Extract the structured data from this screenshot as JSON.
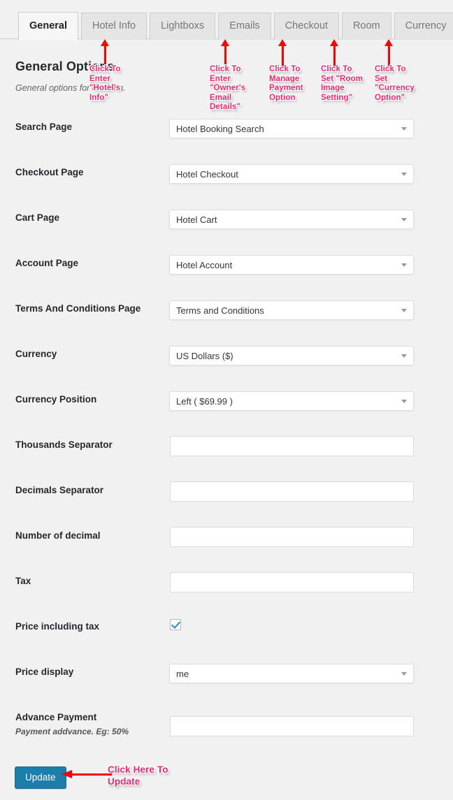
{
  "tabs": [
    {
      "label": "General",
      "active": true
    },
    {
      "label": "Hotel Info",
      "active": false
    },
    {
      "label": "Lightboxs",
      "active": false
    },
    {
      "label": "Emails",
      "active": false
    },
    {
      "label": "Checkout",
      "active": false
    },
    {
      "label": "Room",
      "active": false
    },
    {
      "label": "Currency",
      "active": false
    }
  ],
  "header": {
    "title": "General Options",
    "subtitle": "General options for the item."
  },
  "form": {
    "rows": [
      {
        "label": "Search Page",
        "type": "select",
        "value": "Hotel Booking Search"
      },
      {
        "label": "Checkout Page",
        "type": "select",
        "value": "Hotel Checkout"
      },
      {
        "label": "Cart Page",
        "type": "select",
        "value": "Hotel Cart"
      },
      {
        "label": "Account Page",
        "type": "select",
        "value": "Hotel Account"
      },
      {
        "label": "Terms And Conditions Page",
        "type": "select",
        "value": "Terms and Conditions"
      },
      {
        "label": "Currency",
        "type": "select",
        "value": "US Dollars ($)"
      },
      {
        "label": "Currency Position",
        "type": "select",
        "value": "Left ( $69.99 )"
      },
      {
        "label": "Thousands Separator",
        "type": "text",
        "value": ""
      },
      {
        "label": "Decimals Separator",
        "type": "text",
        "value": ""
      },
      {
        "label": "Number of decimal",
        "type": "text",
        "value": ""
      },
      {
        "label": "Tax",
        "type": "text",
        "value": ""
      },
      {
        "label": "Price including tax",
        "type": "checkbox",
        "checked": true
      },
      {
        "label": "Price display",
        "type": "select",
        "value": "me"
      },
      {
        "label": "Advance Payment",
        "type": "text",
        "value": "",
        "desc": "Payment addvance. Eg: 50%"
      }
    ]
  },
  "update": {
    "label": "Update"
  },
  "annotations": {
    "colors": {
      "arrow": "#ff0000",
      "text": "#f8246b",
      "outline": "#ffffff"
    },
    "callouts": [
      {
        "text": "Click To\nEnter\n\"Hotel's\nInfo\""
      },
      {
        "text": "Click To\nEnter\n\"Owner's\nEmail\nDetails\""
      },
      {
        "text": "Click To\nManage\nPayment\nOption"
      },
      {
        "text": "Click To\nSet \"Room\nImage\nSetting\""
      },
      {
        "text": "Click To\nSet\n\"Currency\nOption\""
      },
      {
        "text": "Click Here To\nUpdate"
      }
    ]
  }
}
